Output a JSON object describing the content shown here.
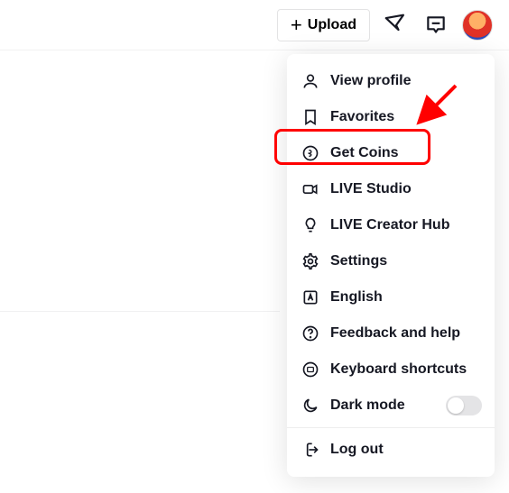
{
  "topbar": {
    "upload_label": "Upload"
  },
  "menu": {
    "view_profile": "View profile",
    "favorites": "Favorites",
    "get_coins": "Get Coins",
    "live_studio": "LIVE Studio",
    "live_creator_hub": "LIVE Creator Hub",
    "settings": "Settings",
    "language": "English",
    "feedback": "Feedback and help",
    "keyboard": "Keyboard shortcuts",
    "dark_mode": "Dark mode",
    "log_out": "Log out"
  }
}
